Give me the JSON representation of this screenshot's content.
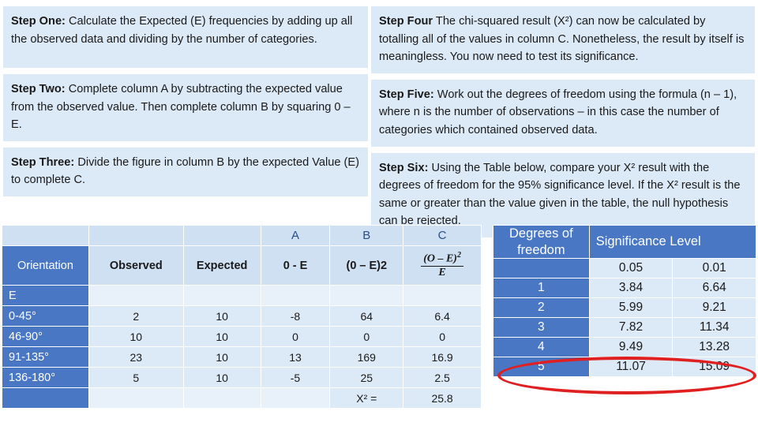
{
  "steps": {
    "left": [
      {
        "label": "Step One:",
        "text": " Calculate the Expected (E) frequencies by adding up all the observed data and dividing by the number of categories."
      },
      {
        "label": "Step Two:",
        "text": " Complete column A by subtracting the expected value from the observed value. Then complete column B by squaring 0 – E."
      },
      {
        "label": "Step Three:",
        "text": " Divide the figure in column B by the expected Value (E) to complete C."
      }
    ],
    "right": [
      {
        "label": "Step Four",
        "text": " The chi-squared result (X²) can now be calculated by totalling all of the values in column C. Nonetheless, the result by itself is meaningless. You now need to test its significance."
      },
      {
        "label": "Step Five:",
        "text": " Work out the degrees of freedom using the formula (n – 1), where n is the number of observations – in this case the number of categories which contained observed data."
      },
      {
        "label": "Step Six:",
        "text": " Using the Table below, compare your X² result with the degrees of freedom for the 95% significance level. If the X² result is the same or greater than the value given in the table, the null hypothesis can be rejected."
      }
    ]
  },
  "main_table": {
    "letter_row": [
      "",
      "",
      "",
      "A",
      "B",
      "C"
    ],
    "headers": [
      "Orientation",
      "Observed",
      "Expected",
      "0 - E",
      "(0 – E)2",
      "formula"
    ],
    "formula": {
      "numerator": "(O – E)",
      "numerator_sup": "2",
      "denominator": "E"
    },
    "blank_row_label": "E",
    "rows": [
      {
        "orientation": "0-45°",
        "observed": "2",
        "expected": "10",
        "a": "-8",
        "b": "64",
        "c": "6.4"
      },
      {
        "orientation": "46-90°",
        "observed": "10",
        "expected": "10",
        "a": "0",
        "b": "0",
        "c": "0"
      },
      {
        "orientation": "91-135°",
        "observed": "23",
        "expected": "10",
        "a": "13",
        "b": "169",
        "c": "16.9"
      },
      {
        "orientation": "136-180°",
        "observed": "5",
        "expected": "10",
        "a": "-5",
        "b": "25",
        "c": "2.5"
      }
    ],
    "total_label": "X² =",
    "total_value": "25.8"
  },
  "df_table": {
    "header_left": "Degrees of freedom",
    "header_right": "Significance Level",
    "sub_headers": [
      "0.05",
      "0.01"
    ],
    "rows": [
      {
        "df": "1",
        "p05": "3.84",
        "p01": "6.64"
      },
      {
        "df": "2",
        "p05": "5.99",
        "p01": "9.21"
      },
      {
        "df": "3",
        "p05": "7.82",
        "p01": "11.34"
      },
      {
        "df": "4",
        "p05": "9.49",
        "p01": "13.28"
      },
      {
        "df": "5",
        "p05": "11.07",
        "p01": "15.09"
      }
    ]
  },
  "annotation": {
    "highlight_color": "#e02020",
    "highlighted_row": "4"
  }
}
